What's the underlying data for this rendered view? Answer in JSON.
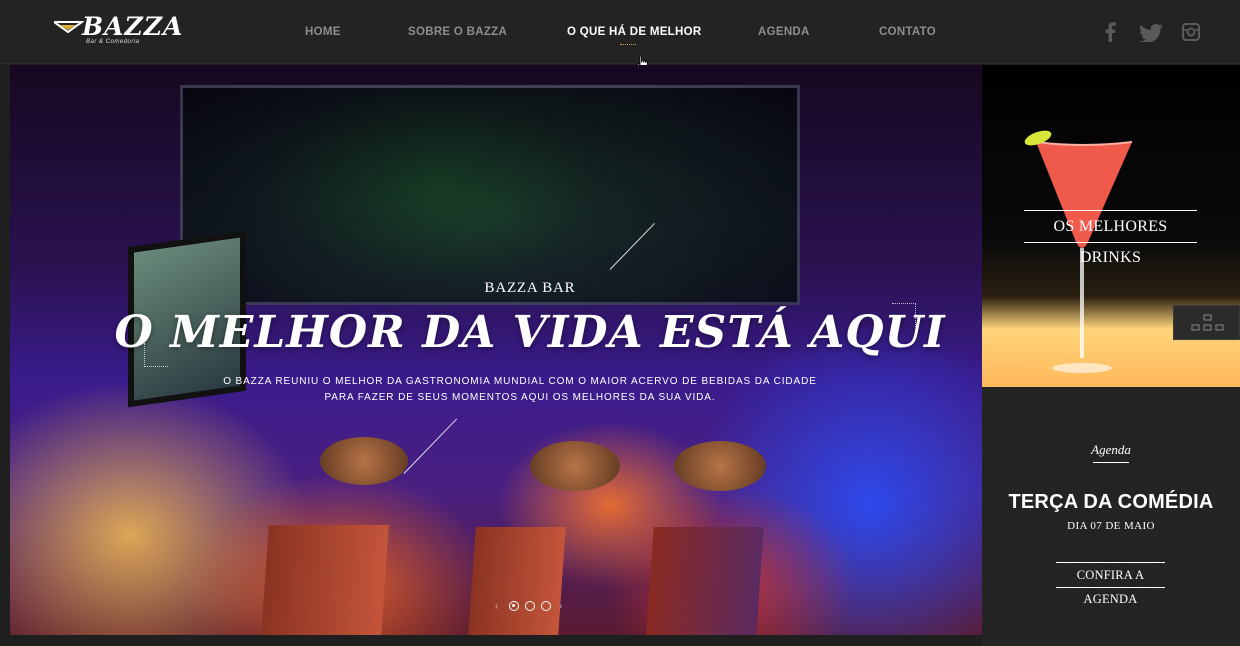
{
  "brand": {
    "name": "BAZZA",
    "tagline": "Bar & Comedoria"
  },
  "nav": {
    "items": [
      {
        "label": "HOME"
      },
      {
        "label": "SOBRE O BAZZA"
      },
      {
        "label": "O QUE HÁ DE MELHOR"
      },
      {
        "label": "AGENDA"
      },
      {
        "label": "CONTATO"
      }
    ],
    "active": "O QUE HÁ DE MELHOR"
  },
  "social": {
    "icons": [
      "facebook-icon",
      "twitter-icon",
      "instagram-icon"
    ]
  },
  "hero": {
    "kicker": "BAZZA BAR",
    "headline": "O MELHOR DA VIDA ESTÁ AQUI",
    "description": "O BAZZA REUNIU O MELHOR DA GASTRONOMIA MUNDIAL COM O MAIOR ACERVO DE BEBIDAS DA CIDADE PARA FAZER DE SEUS MOMENTOS AQUI OS MELHORES DA SUA VIDA.",
    "slides_total": 3,
    "slide_active": 1
  },
  "drinks": {
    "title": "OS MELHORES DRINKS"
  },
  "agenda": {
    "label": "Agenda",
    "event_title": "TERÇA DA COMÉDIA",
    "event_date": "DIA 07 DE MAIO",
    "link_label": "CONFIRA A AGENDA"
  },
  "colors": {
    "header_bg": "#232323",
    "nav_inactive": "#8e8e8e",
    "nav_active": "#ffffff",
    "accent": "#c9a843"
  }
}
